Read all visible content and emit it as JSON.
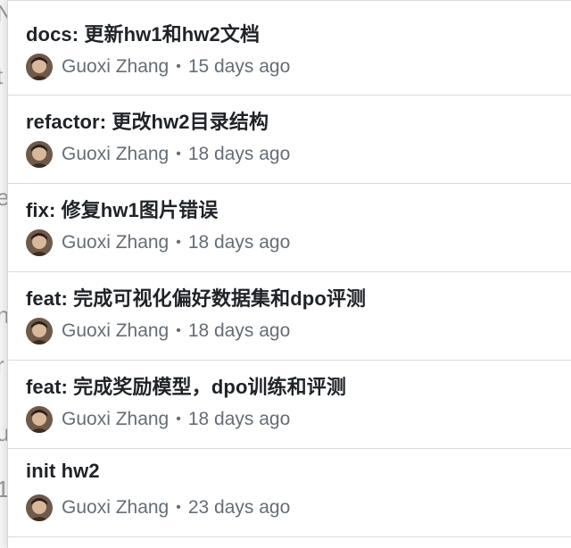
{
  "background_fragments": [
    "N",
    "t",
    "e",
    "n",
    "r",
    "u",
    "1"
  ],
  "commits": [
    {
      "title": "docs: 更新hw1和hw2文档",
      "author": "Guoxi Zhang",
      "separator": "•",
      "age": "15 days ago"
    },
    {
      "title": "refactor: 更改hw2目录结构",
      "author": "Guoxi Zhang",
      "separator": "•",
      "age": "18 days ago"
    },
    {
      "title": "fix: 修复hw1图片错误",
      "author": "Guoxi Zhang",
      "separator": "•",
      "age": "18 days ago"
    },
    {
      "title": "feat: 完成可视化偏好数据集和dpo评测",
      "author": "Guoxi Zhang",
      "separator": "•",
      "age": "18 days ago"
    },
    {
      "title": "feat: 完成奖励模型，dpo训练和评测",
      "author": "Guoxi Zhang",
      "separator": "•",
      "age": "18 days ago"
    },
    {
      "title": "init hw2",
      "author": "Guoxi Zhang",
      "separator": "•",
      "age": "23 days ago"
    }
  ],
  "avatar_icon": "user-avatar"
}
